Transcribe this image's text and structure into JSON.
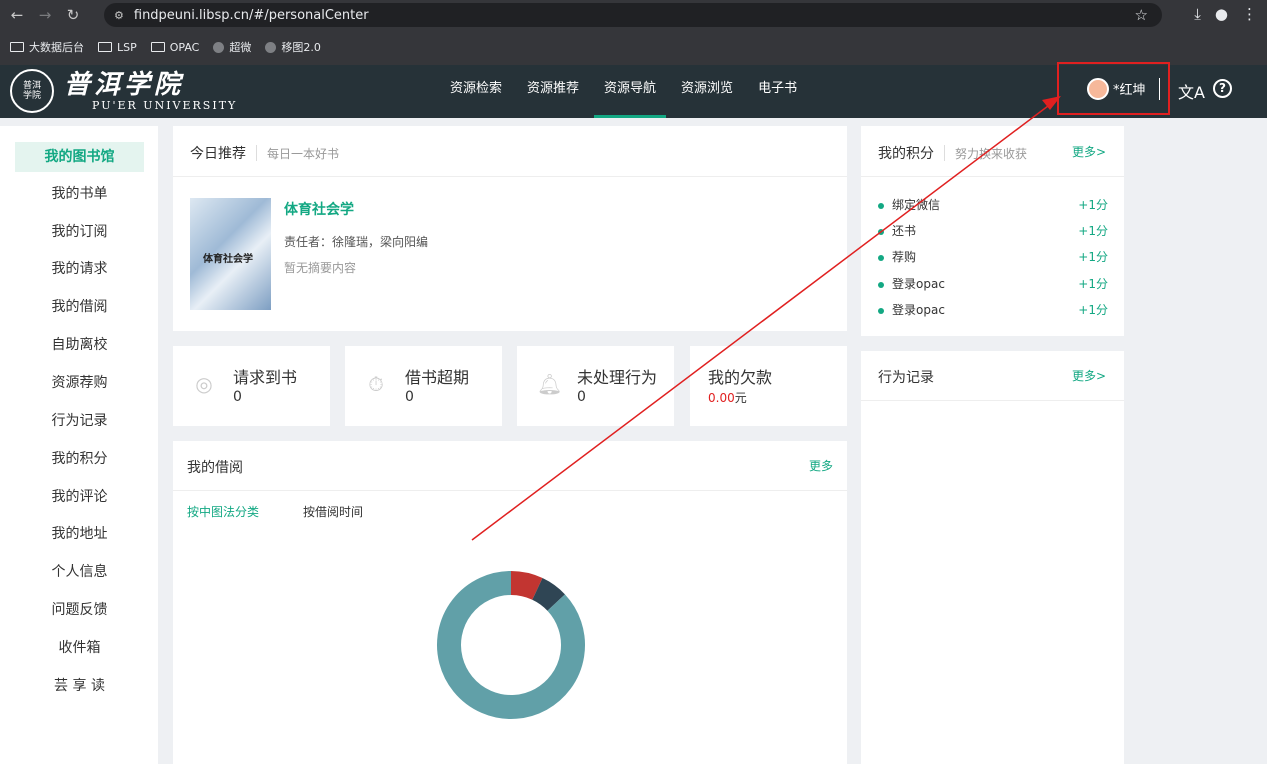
{
  "browser": {
    "url": "findpeuni.libsp.cn/#/personalCenter",
    "bookmarks": [
      {
        "label": "大数据后台",
        "icon": "folder-icon"
      },
      {
        "label": "LSP",
        "icon": "folder-icon"
      },
      {
        "label": "OPAC",
        "icon": "folder-icon"
      },
      {
        "label": "超微",
        "icon": "globe-icon"
      },
      {
        "label": "移图2.0",
        "icon": "globe-icon"
      }
    ]
  },
  "header": {
    "logo_cn": "普洱学院",
    "logo_en": "PU'ER UNIVERSITY",
    "nav": [
      "资源检索",
      "资源推荐",
      "资源导航",
      "资源浏览",
      "电子书"
    ],
    "active_nav": "资源导航",
    "user_name": "*红坤",
    "highlight_color": "#e02020",
    "accent": "#13a883"
  },
  "sidebar": {
    "items": [
      "我的图书馆",
      "我的书单",
      "我的订阅",
      "我的请求",
      "我的借阅",
      "自助离校",
      "资源荐购",
      "行为记录",
      "我的积分",
      "我的评论",
      "我的地址",
      "个人信息",
      "问题反馈",
      "收件箱",
      "芸 享 读"
    ],
    "active": "我的图书馆"
  },
  "recommend": {
    "title": "今日推荐",
    "subtitle": "每日一本好书",
    "book_title": "体育社会学",
    "cover_text": "体育社会学",
    "author": "责任者：徐隆瑞，梁向阳编",
    "abstract": "暂无摘要内容"
  },
  "stats": {
    "request": {
      "label": "请求到书",
      "value": "0"
    },
    "overdue": {
      "label": "借书超期",
      "value": "0"
    },
    "pending": {
      "label": "未处理行为",
      "value": "0"
    },
    "debt": {
      "label": "我的欠款",
      "value": "0.00",
      "unit": "元"
    }
  },
  "borrow": {
    "title": "我的借阅",
    "more": "更多",
    "tabs": [
      "按中图法分类",
      "按借阅时间"
    ]
  },
  "points": {
    "title": "我的积分",
    "subtitle": "努力换来收获",
    "more": "更多>",
    "rows": [
      {
        "label": "绑定微信",
        "points": "+1分"
      },
      {
        "label": "还书",
        "points": "+1分"
      },
      {
        "label": "荐购",
        "points": "+1分"
      },
      {
        "label": "登录opac",
        "points": "+1分"
      },
      {
        "label": "登录opac",
        "points": "+1分"
      }
    ]
  },
  "behavior": {
    "title": "行为记录",
    "more": "更多>"
  },
  "chart_data": {
    "type": "pie",
    "donut": true,
    "values": [
      7,
      6,
      87
    ],
    "colors": [
      "#c23531",
      "#2f4554",
      "#61a0a8"
    ]
  }
}
